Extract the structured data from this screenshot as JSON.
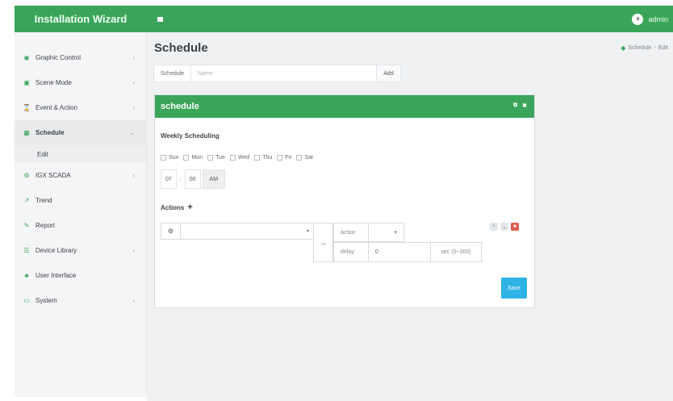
{
  "header": {
    "brand": "Installation Wizard",
    "user_name": "admin",
    "avatar_initial": "a"
  },
  "sidebar": {
    "items": [
      {
        "label": "Graphic Control",
        "icon": "eye-icon"
      },
      {
        "label": "Scene Mode",
        "icon": "image-icon"
      },
      {
        "label": "Event & Action",
        "icon": "hourglass-icon"
      },
      {
        "label": "Schedule",
        "icon": "calendar-icon"
      },
      {
        "label": "Edit"
      },
      {
        "label": "IGX SCADA",
        "icon": "gear-icon"
      },
      {
        "label": "Trend",
        "icon": "line-chart-icon"
      },
      {
        "label": "Report",
        "icon": "pencil-icon"
      },
      {
        "label": "Device Library",
        "icon": "list-icon"
      },
      {
        "label": "User Interface",
        "icon": "users-icon"
      },
      {
        "label": "System",
        "icon": "monitor-icon"
      }
    ]
  },
  "page": {
    "title": "Schedule",
    "breadcrumb": [
      "Schedule",
      "Edit"
    ]
  },
  "schedule_bar": {
    "label": "Schedule",
    "name_placeholder": "Name",
    "add_label": "Add"
  },
  "panel": {
    "title": "schedule",
    "weekly_title": "Weekly Scheduling",
    "days": [
      "Sun",
      "Mon",
      "Tue",
      "Wed",
      "Thu",
      "Fri",
      "Sat"
    ],
    "time": {
      "hour": "07",
      "separator": ":",
      "minute": "00",
      "period": "AM"
    },
    "actions_title": "Actions",
    "action_label": "action",
    "delay_label": "delay",
    "delay_value": "0",
    "delay_unit": "sec (0~300)",
    "save_label": "Save"
  },
  "colors": {
    "accent": "#3aa55a",
    "save": "#2fb3e6",
    "delete": "#e05a4a"
  }
}
